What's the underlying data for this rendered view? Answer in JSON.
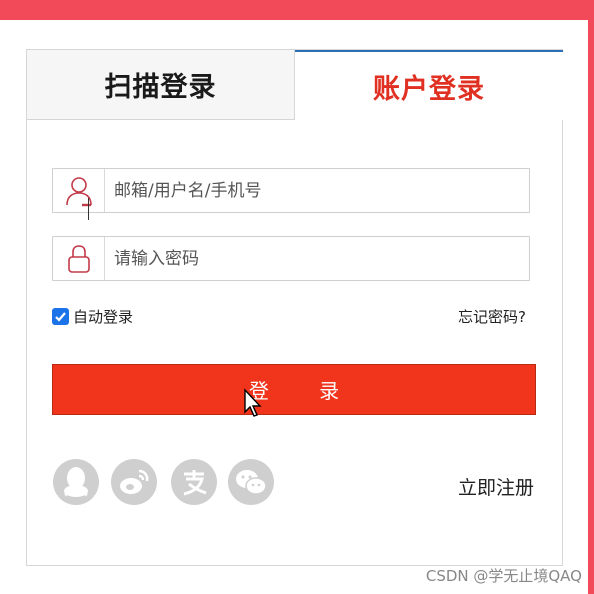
{
  "tabs": [
    {
      "label": "扫描登录",
      "active": false
    },
    {
      "label": "账户登录",
      "active": true
    }
  ],
  "username": {
    "placeholder": "邮箱/用户名/手机号",
    "icon": "user-icon"
  },
  "password": {
    "placeholder": "请输入密码",
    "icon": "lock-icon"
  },
  "remember": {
    "label": "自动登录",
    "checked": true
  },
  "forgot_label": "忘记密码?",
  "login_label": "登 录",
  "social": [
    {
      "name": "qq",
      "icon": "qq-icon"
    },
    {
      "name": "weibo",
      "icon": "weibo-icon"
    },
    {
      "name": "alipay",
      "icon": "alipay-icon"
    },
    {
      "name": "wechat",
      "icon": "wechat-icon"
    }
  ],
  "register_label": "立即注册",
  "watermark": "CSDN @学无止境QAQ",
  "colors": {
    "accent": "#f0351c",
    "active_tab_text": "#e03022",
    "checkbox": "#1a73e8",
    "icon_red": "#c23a48",
    "social_grey": "#cfcfcf",
    "frame": "#f24a58"
  }
}
